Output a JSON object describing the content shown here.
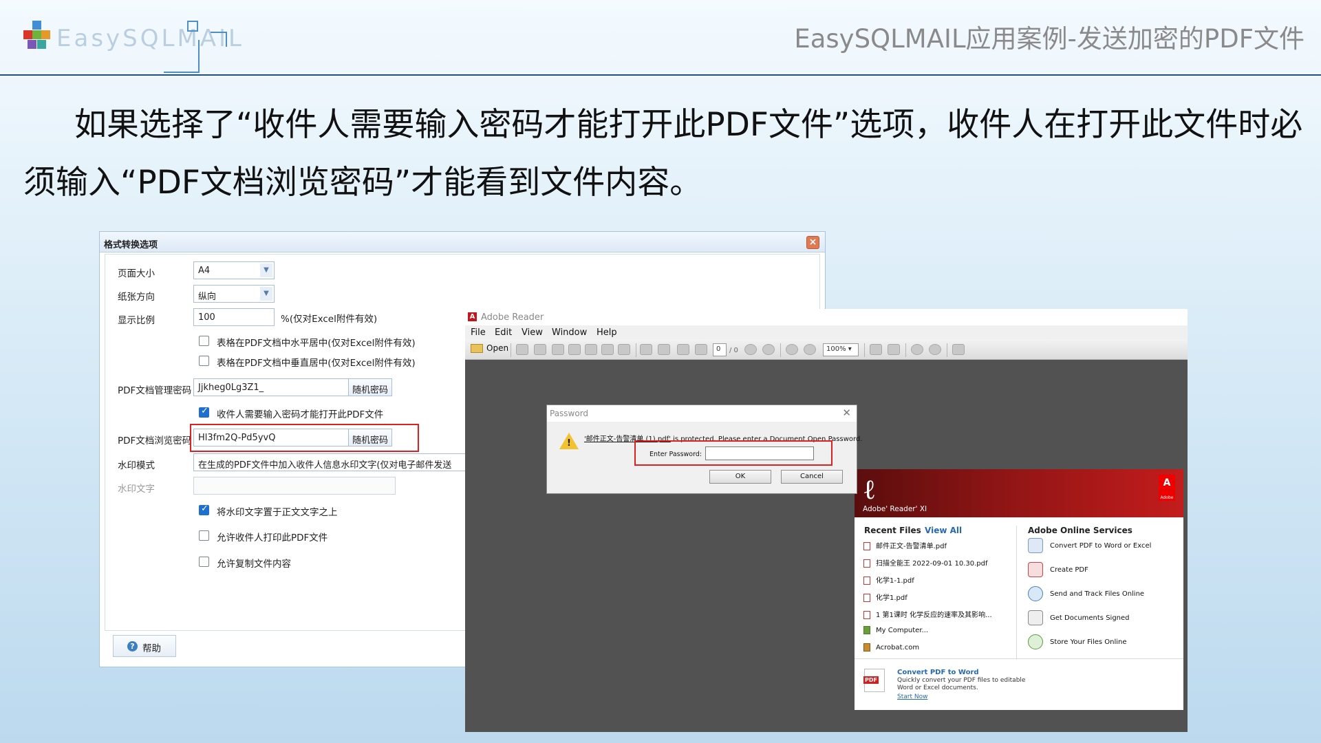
{
  "logo": {
    "text": "EasySQLMAIL"
  },
  "slide_title": "EasySQLMAIL应用案例-发送加密的PDF文件",
  "body_text": "如果选择了“收件人需要输入密码才能打开此PDF文件”选项，收件人在打开此文件时必须输入“PDF文档浏览密码”才能看到文件内容。",
  "options_dialog": {
    "title": "格式转换选项",
    "page_size_label": "页面大小",
    "page_size_value": "A4",
    "orientation_label": "纸张方向",
    "orientation_value": "纵向",
    "scale_label": "显示比例",
    "scale_value": "100",
    "scale_suffix": "%(仅对Excel附件有效)",
    "checkbox_center_h": "表格在PDF文档中水平居中(仅对Excel附件有效)",
    "checkbox_center_v": "表格在PDF文档中垂直居中(仅对Excel附件有效)",
    "admin_pwd_label": "PDF文档管理密码",
    "admin_pwd_value": "Jjkheg0Lg3Z1_",
    "random_pwd_button": "随机密码",
    "require_pwd_checkbox": "收件人需要输入密码才能打开此PDF文件",
    "view_pwd_label": "PDF文档浏览密码",
    "view_pwd_value": "Hl3fm2Q-Pd5yvQ",
    "watermark_mode_label": "水印模式",
    "watermark_mode_value": "在生成的PDF文件中加入收件人信息水印文字(仅对电子邮件发送",
    "watermark_text_label": "水印文字",
    "watermark_text_value": "",
    "watermark_above_checkbox": "将水印文字置于正文文字之上",
    "allow_print_checkbox": "允许收件人打印此PDF文件",
    "allow_copy_checkbox": "允许复制文件内容",
    "help_button": "帮助",
    "checks": {
      "center_h": false,
      "center_v": false,
      "require_pwd": true,
      "watermark_above": true,
      "allow_print": false,
      "allow_copy": false
    }
  },
  "adobe_reader": {
    "title": "Adobe Reader",
    "menus": [
      "File",
      "Edit",
      "View",
      "Window",
      "Help"
    ],
    "open_button": "Open",
    "page_number": "0",
    "page_total": "/ 0",
    "zoom": "100%"
  },
  "password_dialog": {
    "title": "Password",
    "message_filename": "'邮件正文-告警清单 (1).pdf'",
    "message_rest": " is protected. Please enter a Document Open Password.",
    "enter_label": "Enter Password:",
    "ok_button": "OK",
    "cancel_button": "Cancel"
  },
  "welcome": {
    "product": "Adobe' Reader' XI",
    "brand_letter": "A",
    "brand_small": "Adobe",
    "recent_header": "Recent Files",
    "view_all": "View All",
    "recent_files": [
      "邮件正文-告警清单.pdf",
      "扫描全能王 2022-09-01 10.30.pdf",
      "化学1-1.pdf",
      "化学1.pdf",
      "1 第1课时   化学反应的速率及其影响...",
      "My Computer...",
      "Acrobat.com"
    ],
    "services_header": "Adobe Online Services",
    "services": [
      "Convert PDF to Word or Excel",
      "Create PDF",
      "Send and Track Files Online",
      "Get Documents Signed",
      "Store Your Files Online"
    ],
    "promo_icon": "PDF",
    "promo_title": "Convert PDF to Word",
    "promo_desc": "Quickly convert your PDF files to editable Word or Excel documents.",
    "promo_link": "Start Now"
  }
}
